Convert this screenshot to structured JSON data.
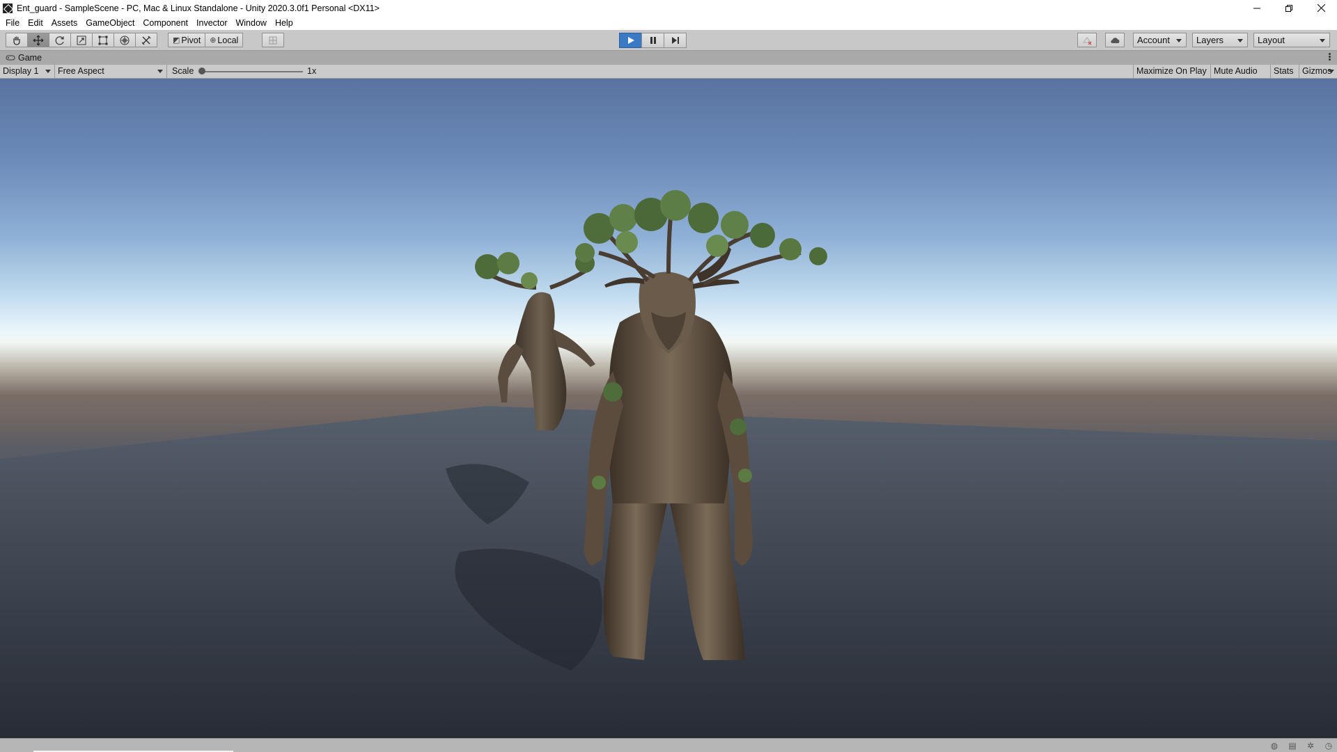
{
  "window": {
    "title": "Ent_guard - SampleScene - PC, Mac & Linux Standalone - Unity 2020.3.0f1 Personal <DX11>",
    "minimize_icon": "minimize-icon",
    "restore_icon": "restore-icon",
    "close_icon": "close-icon"
  },
  "menu": [
    "File",
    "Edit",
    "Assets",
    "GameObject",
    "Component",
    "Invector",
    "Window",
    "Help"
  ],
  "toolbar": {
    "tools": [
      "hand-tool-icon",
      "move-tool-icon",
      "rotate-tool-icon",
      "scale-tool-icon",
      "rect-tool-icon",
      "transform-tool-icon",
      "custom-tool-icon"
    ],
    "pivot_label": "Pivot",
    "local_label": "Local",
    "account_label": "Account",
    "layers_label": "Layers",
    "layout_label": "Layout",
    "play_color": "#3a79c4"
  },
  "game_tab": {
    "label": "Game"
  },
  "game_bar": {
    "display": "Display 1",
    "aspect": "Free Aspect",
    "scale_label": "Scale",
    "scale_value": "1x",
    "maximize_on_play": "Maximize On Play",
    "mute_audio": "Mute Audio",
    "stats": "Stats",
    "gizmos": "Gizmos"
  }
}
